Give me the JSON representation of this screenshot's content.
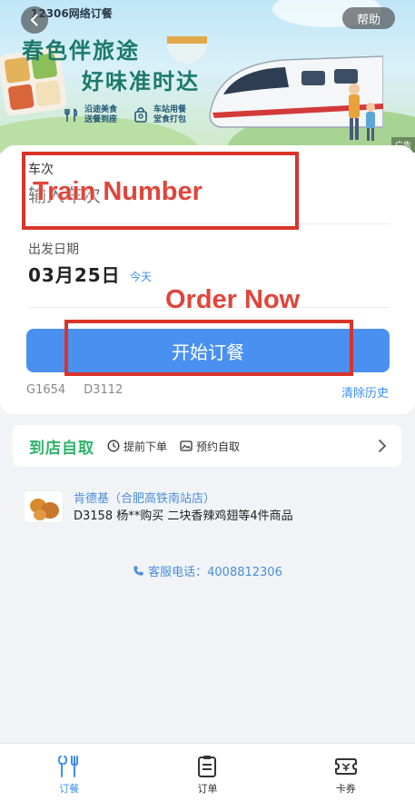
{
  "banner": {
    "brand": "12306网络订餐",
    "help_label": "帮助",
    "slogan_line1": "春色伴旅途",
    "slogan_line2": "好味准时达",
    "features": [
      {
        "text": "沿途美食\n送餐到座",
        "icon": "fork-knife-icon"
      },
      {
        "text": "车站用餐\n堂食打包",
        "icon": "bag-icon"
      }
    ],
    "ad_tag": "广告"
  },
  "form": {
    "train_label": "车次",
    "train_placeholder": "输入车次",
    "date_label": "出发日期",
    "date_value": "03月25日",
    "date_hint": "今天",
    "order_button": "开始订餐",
    "history": [
      "G1654",
      "D3112"
    ],
    "clear_history": "清除历史"
  },
  "pickup": {
    "title": "到店自取",
    "options": [
      {
        "label": "提前下单",
        "icon": "clock-icon"
      },
      {
        "label": "预约自取",
        "icon": "image-icon"
      }
    ]
  },
  "recent_order": {
    "store": "肯德基（合肥高铁南站店）",
    "description": "D3158 杨**购买 二块香辣鸡翅等4件商品"
  },
  "service": {
    "text": "客服电话：4008812306"
  },
  "annotations": {
    "train_number": "Train Number",
    "order_now": "Order Now"
  },
  "nav": [
    {
      "label": "订餐",
      "icon": "meal-icon",
      "active": true
    },
    {
      "label": "订单",
      "icon": "order-list-icon",
      "active": false
    },
    {
      "label": "卡券",
      "icon": "ticket-icon",
      "active": false
    }
  ],
  "colors": {
    "accent": "#4a90f0",
    "pickup_green": "#2db36a",
    "annotation_red": "#d9342b"
  }
}
